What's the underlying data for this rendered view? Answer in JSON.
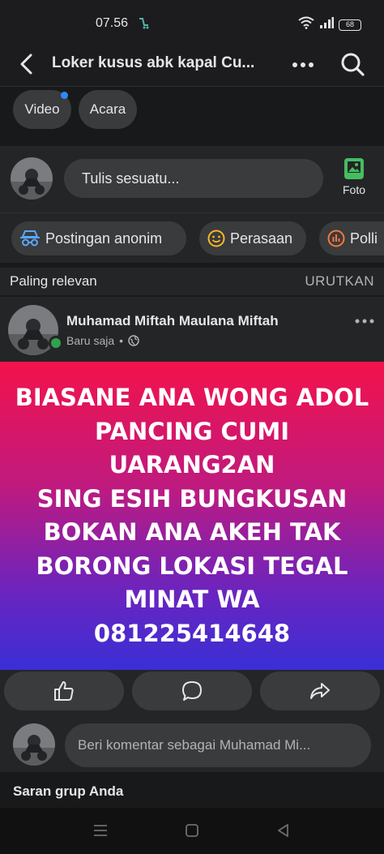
{
  "status": {
    "time": "07.56",
    "battery": "68"
  },
  "header": {
    "title": "Loker kusus abk kapal Cu..."
  },
  "chips": [
    {
      "label": "Video"
    },
    {
      "label": "Acara"
    }
  ],
  "composer": {
    "placeholder": "Tulis sesuatu...",
    "photo_label": "Foto"
  },
  "post_options": [
    {
      "label": "Postingan anonim",
      "icon": "incognito-icon"
    },
    {
      "label": "Perasaan",
      "icon": "smiley-icon"
    },
    {
      "label": "Polli",
      "icon": "poll-icon"
    }
  ],
  "sort": {
    "left": "Paling relevan",
    "right": "URUTKAN"
  },
  "post": {
    "author": "Muhamad Miftah Maulana Miftah",
    "time": "Baru saja",
    "separator": "•",
    "lines": [
      "BIASANE ANA WONG ADOL",
      "PANCING CUMI UARANG2AN",
      "SING ESIH BUNGKUSAN",
      "BOKAN ANA AKEH TAK",
      "BORONG LOKASI TEGAL",
      "MINAT WA",
      "081225414648"
    ]
  },
  "comment": {
    "placeholder": "Beri komentar sebagai Muhamad Mi..."
  },
  "suggestions": {
    "title": "Saran grup Anda"
  },
  "colors": {
    "accent": "#2d88ff",
    "online": "#31a24c",
    "photo": "#45bd62"
  }
}
